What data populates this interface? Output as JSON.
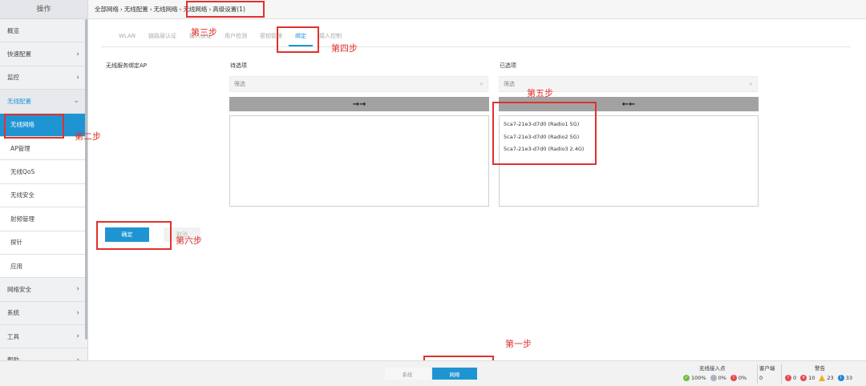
{
  "sidebar": {
    "header": "操作",
    "items": [
      {
        "label": "概览",
        "chevron": ""
      },
      {
        "label": "快速配置",
        "chevron": "›"
      },
      {
        "label": "监控",
        "chevron": "›"
      },
      {
        "label": "无线配置",
        "chevron": "⌄"
      }
    ],
    "subitems": [
      "无线网络",
      "AP管理",
      "无线QoS",
      "无线安全",
      "射频管理",
      "探针",
      "应用"
    ],
    "bottom_items": [
      {
        "label": "网络安全",
        "chevron": "›"
      },
      {
        "label": "系统",
        "chevron": "›"
      },
      {
        "label": "工具",
        "chevron": "›"
      },
      {
        "label": "帮助",
        "chevron": "›"
      }
    ]
  },
  "breadcrumb": [
    "全部网络",
    "无线配置",
    "无线网络",
    "无线网络",
    "高级设置(1)"
  ],
  "breadcrumb_sep": "›",
  "tabs": [
    "WLAN",
    "链路层认证",
    "接入认证",
    "用户检测",
    "密钥管理",
    "绑定",
    "接入控制"
  ],
  "form": {
    "left_label": "无线服务绑定AP",
    "available_title": "待选项",
    "selected_title": "已选项",
    "filter_placeholder": "筛选",
    "move_right": "→→",
    "move_left": "←←",
    "selected_items": [
      "5ca7-21e3-d7d0 (Radio1 5G)",
      "5ca7-21e3-d7d0 (Radio2 5G)",
      "5ca7-21e3-d7d0 (Radio3 2.4G)"
    ],
    "ok_label": "确定",
    "cancel_label": "取消"
  },
  "annotations": {
    "step1": "第一步",
    "step2": "第二步",
    "step3": "第三步",
    "step4": "第四步",
    "step5": "第五步",
    "step6": "第六步"
  },
  "bottom": {
    "system_tab": "系统",
    "network_tab": "网络",
    "ap_title": "无线接入点",
    "ap_online": "100%",
    "ap_offline": "0%",
    "ap_fault": "0%",
    "client_title": "客户端",
    "client_count": "0",
    "alarm_title": "警告",
    "alarm_critical": "0",
    "alarm_major": "10",
    "alarm_minor": "23",
    "alarm_info": "33"
  },
  "colors": {
    "accent": "#1f94d2",
    "annotation": "#e0312e"
  }
}
